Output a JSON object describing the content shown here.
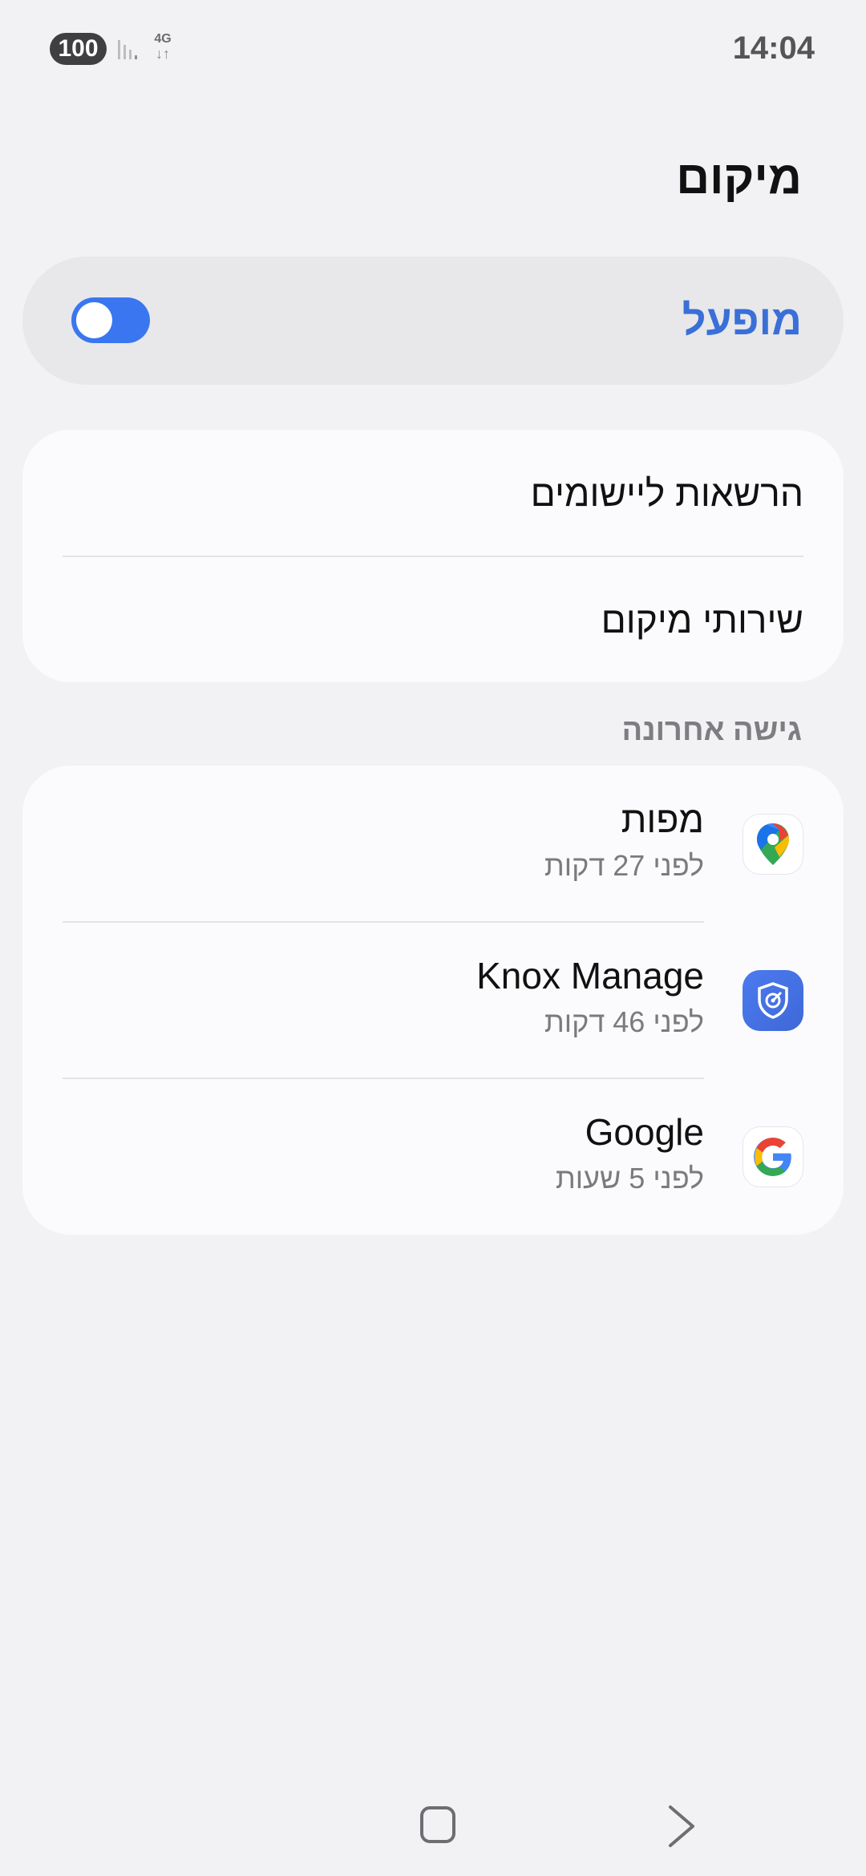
{
  "status_bar": {
    "battery": "100",
    "network_type": "4G",
    "data_arrows": "↓↑",
    "time": "14:04",
    "signal_icon": "signal-bars-icon"
  },
  "title": "מיקום",
  "master_switch": {
    "label": "מופעל",
    "state": "on",
    "accent_color": "#3a76f0"
  },
  "settings_items": [
    {
      "label": "הרשאות ליישומים"
    },
    {
      "label": "שירותי מיקום"
    }
  ],
  "recent_access": {
    "header": "גישה אחרונה",
    "apps": [
      {
        "name": "מפות",
        "time": "לפני 27 דקות",
        "icon": "google-maps-icon"
      },
      {
        "name": "Knox Manage",
        "time": "לפני 46 דקות",
        "icon": "knox-manage-icon"
      },
      {
        "name": "Google",
        "time": "לפני 5 שעות",
        "icon": "google-icon"
      }
    ]
  },
  "nav_bar": {
    "home_icon": "home-icon",
    "back_icon": "back-icon"
  }
}
